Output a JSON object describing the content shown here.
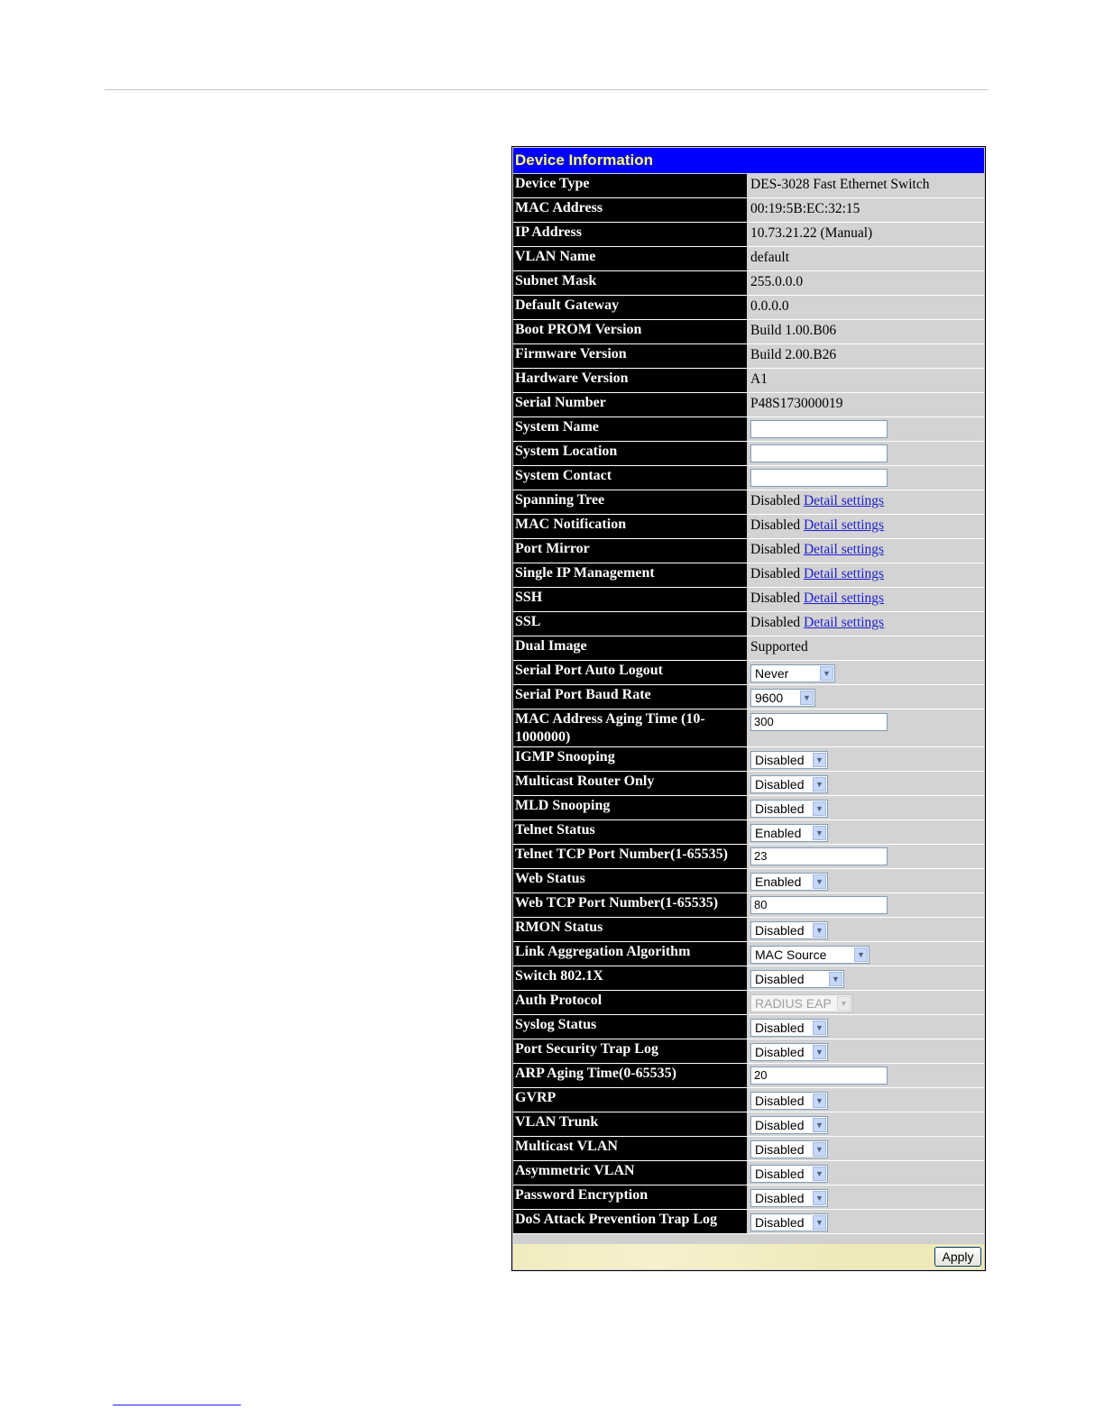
{
  "panel": {
    "title": "Device Information",
    "apply_label": "Apply"
  },
  "rows": [
    {
      "label": "Device Type",
      "type": "text",
      "value": "DES-3028 Fast Ethernet Switch"
    },
    {
      "label": "MAC Address",
      "type": "text",
      "value": "00:19:5B:EC:32:15"
    },
    {
      "label": "IP Address",
      "type": "text",
      "value": "10.73.21.22 (Manual)"
    },
    {
      "label": "VLAN Name",
      "type": "text",
      "value": "default"
    },
    {
      "label": "Subnet Mask",
      "type": "text",
      "value": "255.0.0.0"
    },
    {
      "label": "Default Gateway",
      "type": "text",
      "value": "0.0.0.0"
    },
    {
      "label": "Boot PROM Version",
      "type": "text",
      "value": "Build 1.00.B06"
    },
    {
      "label": "Firmware Version",
      "type": "text",
      "value": "Build 2.00.B26"
    },
    {
      "label": "Hardware Version",
      "type": "text",
      "value": "A1"
    },
    {
      "label": "Serial Number",
      "type": "text",
      "value": "P48S173000019"
    },
    {
      "label": "System Name",
      "type": "input",
      "value": ""
    },
    {
      "label": "System Location",
      "type": "input",
      "value": ""
    },
    {
      "label": "System Contact",
      "type": "input",
      "value": ""
    },
    {
      "label": "Spanning Tree",
      "type": "link",
      "value": "Disabled",
      "link": "Detail settings"
    },
    {
      "label": "MAC Notification",
      "type": "link",
      "value": "Disabled",
      "link": "Detail settings"
    },
    {
      "label": "Port Mirror",
      "type": "link",
      "value": "Disabled",
      "link": "Detail settings"
    },
    {
      "label": "Single IP Management",
      "type": "link",
      "value": "Disabled",
      "link": "Detail settings"
    },
    {
      "label": "SSH",
      "type": "link",
      "value": "Disabled",
      "link": "Detail settings"
    },
    {
      "label": "SSL",
      "type": "link",
      "value": "Disabled",
      "link": "Detail settings"
    },
    {
      "label": "Dual Image",
      "type": "text",
      "value": "Supported"
    },
    {
      "label": "Serial Port Auto Logout",
      "type": "select",
      "value": "Never",
      "w": "wide"
    },
    {
      "label": "Serial Port Baud Rate",
      "type": "select",
      "value": "9600",
      "w": "short"
    },
    {
      "label": "MAC Address Aging Time (10-1000000)",
      "type": "input",
      "value": "300",
      "tall": true
    },
    {
      "label": "IGMP Snooping",
      "type": "select",
      "value": "Disabled"
    },
    {
      "label": "Multicast Router Only",
      "type": "select",
      "value": "Disabled"
    },
    {
      "label": "MLD Snooping",
      "type": "select",
      "value": "Disabled"
    },
    {
      "label": "Telnet Status",
      "type": "select",
      "value": "Enabled"
    },
    {
      "label": "Telnet TCP Port Number(1-65535)",
      "type": "input",
      "value": "23"
    },
    {
      "label": "Web Status",
      "type": "select",
      "value": "Enabled"
    },
    {
      "label": "Web TCP Port Number(1-65535)",
      "type": "input",
      "value": "80"
    },
    {
      "label": "RMON Status",
      "type": "select",
      "value": "Disabled"
    },
    {
      "label": "Link Aggregation Algorithm",
      "type": "select",
      "value": "MAC Source",
      "w": "xwide"
    },
    {
      "label": "Switch 802.1X",
      "type": "select",
      "value": "Disabled",
      "w": "mid"
    },
    {
      "label": "Auth Protocol",
      "type": "select",
      "value": "RADIUS EAP",
      "disabled": true,
      "w": "auth"
    },
    {
      "label": "Syslog Status",
      "type": "select",
      "value": "Disabled"
    },
    {
      "label": "Port Security Trap Log",
      "type": "select",
      "value": "Disabled"
    },
    {
      "label": "ARP Aging Time(0-65535)",
      "type": "input",
      "value": "20"
    },
    {
      "label": "GVRP",
      "type": "select",
      "value": "Disabled"
    },
    {
      "label": "VLAN Trunk",
      "type": "select",
      "value": "Disabled"
    },
    {
      "label": "Multicast VLAN",
      "type": "select",
      "value": "Disabled"
    },
    {
      "label": "Asymmetric VLAN",
      "type": "select",
      "value": "Disabled"
    },
    {
      "label": "Password Encryption",
      "type": "select",
      "value": "Disabled"
    },
    {
      "label": "DoS Attack Prevention Trap Log",
      "type": "select",
      "value": "Disabled"
    }
  ]
}
